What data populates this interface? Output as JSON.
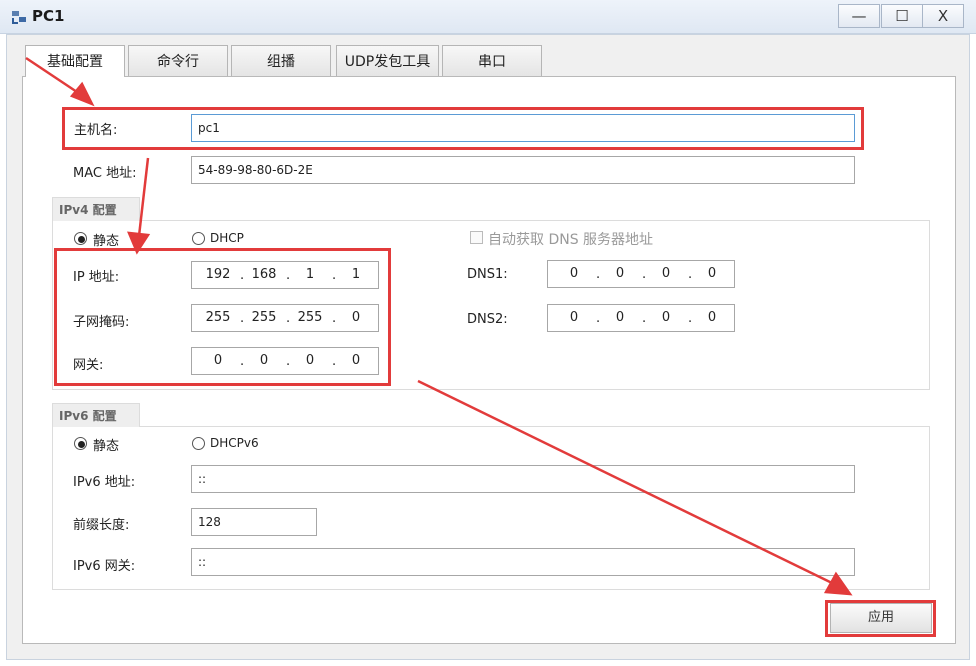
{
  "window": {
    "title": "PC1",
    "min_glyph": "—",
    "max_glyph": "☐",
    "close_glyph": "X"
  },
  "tabs": [
    {
      "label": "基础配置",
      "active": true
    },
    {
      "label": "命令行"
    },
    {
      "label": "组播"
    },
    {
      "label": "UDP发包工具"
    },
    {
      "label": "串口"
    }
  ],
  "basic": {
    "hostname_label": "主机名:",
    "hostname_value": "pc1",
    "mac_label": "MAC 地址:",
    "mac_value": "54-89-98-80-6D-2E"
  },
  "ipv4": {
    "group_title": "IPv4 配置",
    "static_label": "静态",
    "dhcp_label": "DHCP",
    "auto_dns_label": "自动获取 DNS 服务器地址",
    "ip_label": "IP 地址:",
    "ip": [
      "192",
      "168",
      "1",
      "1"
    ],
    "mask_label": "子网掩码:",
    "mask": [
      "255",
      "255",
      "255",
      "0"
    ],
    "gateway_label": "网关:",
    "gateway": [
      "0",
      "0",
      "0",
      "0"
    ],
    "dns1_label": "DNS1:",
    "dns1": [
      "0",
      "0",
      "0",
      "0"
    ],
    "dns2_label": "DNS2:",
    "dns2": [
      "0",
      "0",
      "0",
      "0"
    ]
  },
  "ipv6": {
    "group_title": "IPv6 配置",
    "static_label": "静态",
    "dhcp_label": "DHCPv6",
    "ip_label": "IPv6 地址:",
    "ip_value": "::",
    "prefix_label": "前缀长度:",
    "prefix_value": "128",
    "gateway_label": "IPv6 网关:",
    "gateway_value": "::"
  },
  "apply_label": "应用",
  "colors": {
    "annotation": "#e23b3b",
    "focus_border": "#5b9bd5"
  }
}
